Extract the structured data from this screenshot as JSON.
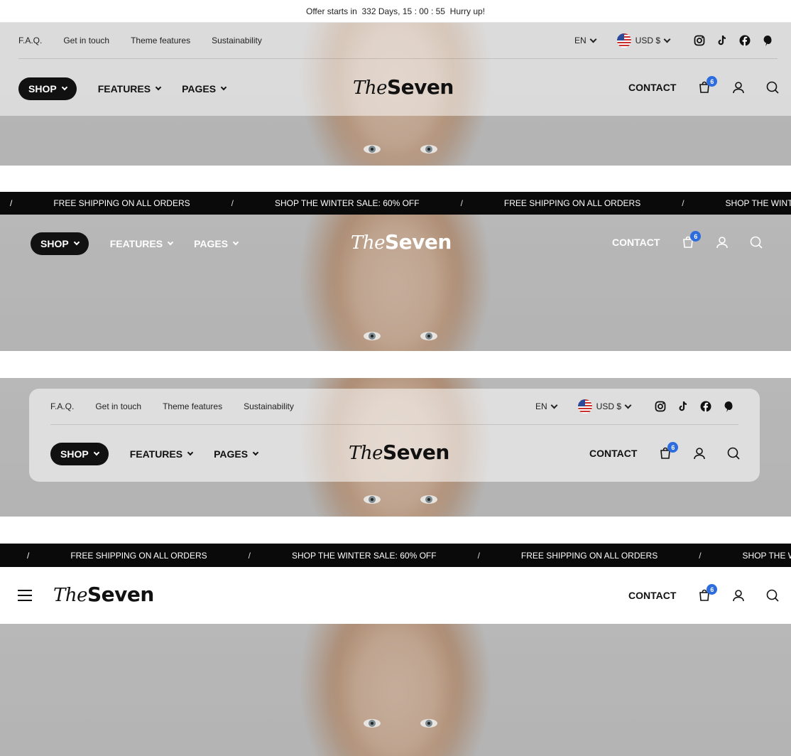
{
  "offer_bar": {
    "prefix": "Offer starts in",
    "days": "332",
    "days_label": "Days,",
    "hours": "15",
    "minutes": "00",
    "seconds": "55",
    "suffix": "Hurry up!"
  },
  "utility_links": [
    "F.A.Q.",
    "Get in touch",
    "Theme features",
    "Sustainability"
  ],
  "language": "EN",
  "currency": "USD $",
  "social_icons": [
    "instagram-icon",
    "tiktok-icon",
    "facebook-icon",
    "pinterest-icon"
  ],
  "nav": {
    "shop_label": "SHOP",
    "features_label": "FEATURES",
    "pages_label": "PAGES",
    "contact_label": "CONTACT",
    "cart_count": "6"
  },
  "logo": {
    "part1": "The",
    "part2": "Seven"
  },
  "ticker": {
    "slash": "/",
    "msg1": "FREE SHIPPING ON ALL ORDERS",
    "msg2": "SHOP THE WINTER SALE: 60% OFF",
    "msg2_truncated_a": "SHOP THE WINTER SA",
    "msg2_truncated_b": "SHOP THE WINTE"
  },
  "colors": {
    "accent_badge": "#2d6cdf",
    "dark": "#111111"
  }
}
